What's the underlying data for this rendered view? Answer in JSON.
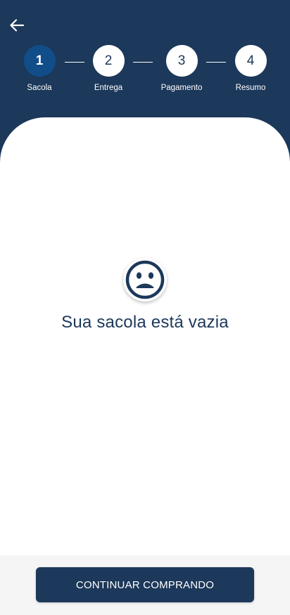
{
  "header": {
    "back_icon": "arrow-left-icon",
    "steps": [
      {
        "number": "1",
        "label": "Sacola",
        "active": true
      },
      {
        "number": "2",
        "label": "Entrega",
        "active": false
      },
      {
        "number": "3",
        "label": "Pagamento",
        "active": false
      },
      {
        "number": "4",
        "label": "Resumo",
        "active": false
      }
    ]
  },
  "empty_state": {
    "icon": "sad-face-icon",
    "message": "Sua sacola está vazia"
  },
  "footer": {
    "continue_label": "CONTINUAR COMPRANDO"
  },
  "colors": {
    "primary": "#1c385a",
    "active_step": "#114d89",
    "footer_bg": "#f5f5f5"
  }
}
